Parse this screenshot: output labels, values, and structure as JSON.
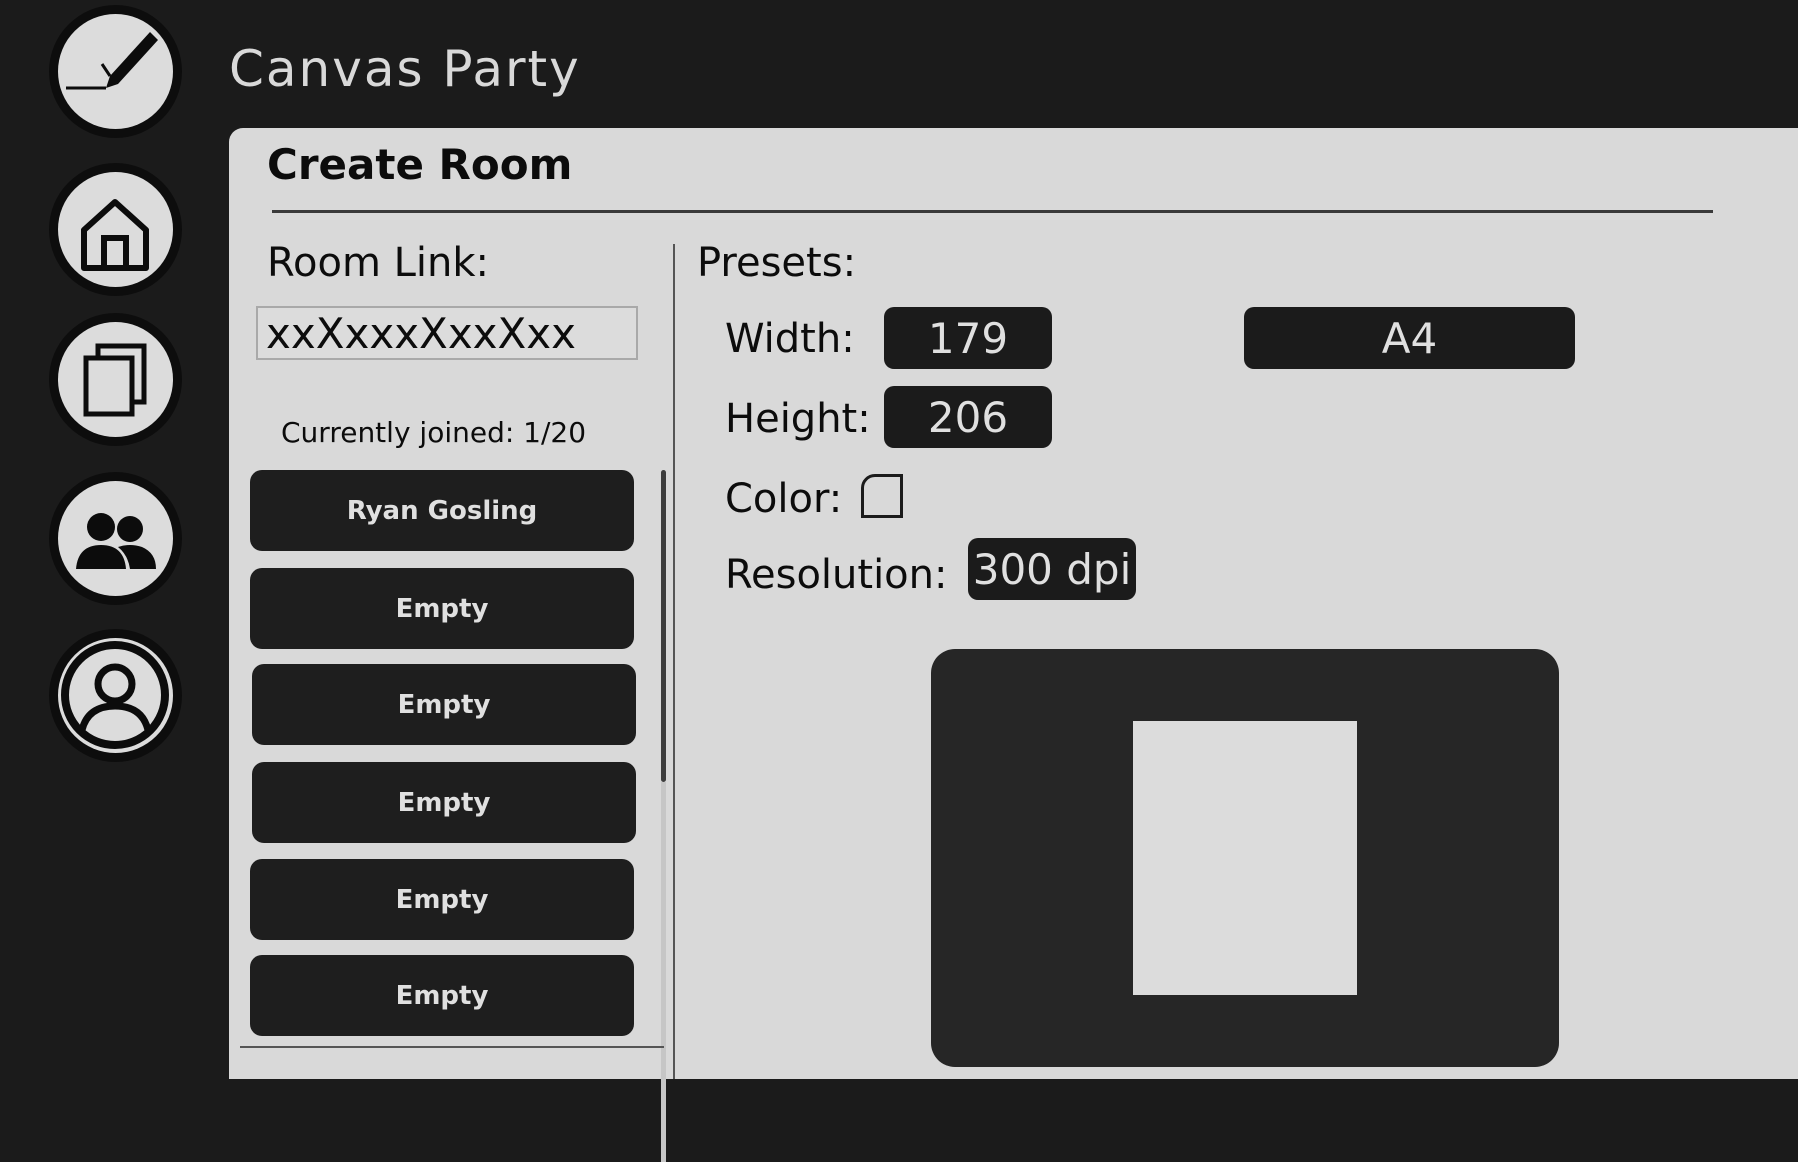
{
  "app": {
    "title": "Canvas Party"
  },
  "sidebar": {
    "items": [
      {
        "name": "logo-brush",
        "icon": "brush-icon"
      },
      {
        "name": "home",
        "icon": "home-icon"
      },
      {
        "name": "documents",
        "icon": "documents-icon"
      },
      {
        "name": "friends",
        "icon": "group-icon"
      },
      {
        "name": "profile",
        "icon": "user-icon"
      }
    ]
  },
  "panel": {
    "title": "Create Room",
    "room_link_label": "Room Link:",
    "room_link_value": "xxXxxxXxxXxx",
    "joined_text": "Currently joined: 1/20",
    "slots": [
      "Ryan Gosling",
      "Empty",
      "Empty",
      "Empty",
      "Empty",
      "Empty"
    ]
  },
  "presets": {
    "label": "Presets:",
    "width_label": "Width:",
    "width_value": "179",
    "height_label": "Height:",
    "height_value": "206",
    "color_label": "Color:",
    "resolution_label": "Resolution:",
    "resolution_value": "300 dpi",
    "paper_preset": "A4"
  },
  "colors": {
    "background": "#1b1b1b",
    "panel": "#d9d9d9",
    "pill": "#1b1b1b",
    "preview": "#262626"
  }
}
